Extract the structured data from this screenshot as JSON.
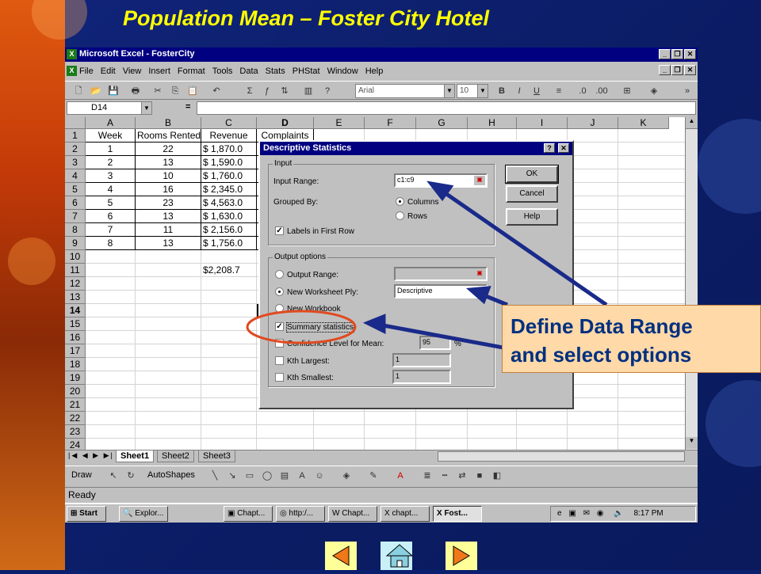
{
  "slide_title": "Population Mean – Foster City Hotel",
  "window": {
    "title": "Microsoft Excel - FosterCity"
  },
  "menu": [
    "File",
    "Edit",
    "View",
    "Insert",
    "Format",
    "Tools",
    "Data",
    "Stats",
    "PHStat",
    "Window",
    "Help"
  ],
  "toolbar": {
    "font": "Arial",
    "size": "10"
  },
  "name_box": "D14",
  "formula_eq": "=",
  "columns": [
    "A",
    "B",
    "C",
    "D",
    "E",
    "F",
    "G",
    "H",
    "I",
    "J",
    "K"
  ],
  "rows": [
    "1",
    "2",
    "3",
    "4",
    "5",
    "6",
    "7",
    "8",
    "9",
    "10",
    "11",
    "12",
    "13",
    "14",
    "15",
    "16",
    "17",
    "18",
    "19",
    "20",
    "21",
    "22",
    "23",
    "24"
  ],
  "table": {
    "headers": [
      "Week",
      "Rooms Rented",
      "Revenue",
      "Complaints"
    ],
    "rows": [
      [
        "1",
        "22",
        "$ 1,870.0"
      ],
      [
        "2",
        "13",
        "$ 1,590.0"
      ],
      [
        "3",
        "10",
        "$ 1,760.0"
      ],
      [
        "4",
        "16",
        "$ 2,345.0"
      ],
      [
        "5",
        "23",
        "$ 4,563.0"
      ],
      [
        "6",
        "13",
        "$ 1,630.0"
      ],
      [
        "7",
        "11",
        "$ 2,156.0"
      ],
      [
        "8",
        "13",
        "$ 1,756.0"
      ]
    ],
    "mean_cell": "$2,208.7"
  },
  "sheet_tabs": [
    "Sheet1",
    "Sheet2",
    "Sheet3"
  ],
  "draw_bar": {
    "draw": "Draw",
    "autoshapes": "AutoShapes"
  },
  "status": "Ready",
  "taskbar": {
    "start": "Start",
    "items": [
      "Explor...",
      "Chapt...",
      "http:/...",
      "Chapt...",
      "chapt...",
      "Fost..."
    ],
    "clock": "8:17 PM"
  },
  "dialog": {
    "title": "Descriptive Statistics",
    "input_group": "Input",
    "input_range_label": "Input Range:",
    "input_range_value": "c1:c9",
    "grouped_by_label": "Grouped By:",
    "columns": "Columns",
    "rows": "Rows",
    "labels_first_row": "Labels in First Row",
    "output_group": "Output options",
    "output_range": "Output Range:",
    "new_ws": "New Worksheet Ply:",
    "new_ws_value": "Descriptive",
    "new_wb": "New Workbook",
    "summary": "Summary statistics",
    "confidence": "Confidence Level for Mean:",
    "confidence_value": "95",
    "pct": "%",
    "kth_largest": "Kth Largest:",
    "kth_largest_value": "1",
    "kth_smallest": "Kth Smallest:",
    "kth_smallest_value": "1",
    "ok": "OK",
    "cancel": "Cancel",
    "help": "Help"
  },
  "callout": {
    "line1": "Define Data Range",
    "line2": "and select options"
  },
  "colors": {
    "title": "#ffff00",
    "callout_bg": "#ffd9a8",
    "callout_text": "#003080",
    "arrow": "#1a2a8a",
    "highlight": "#e04a20"
  }
}
